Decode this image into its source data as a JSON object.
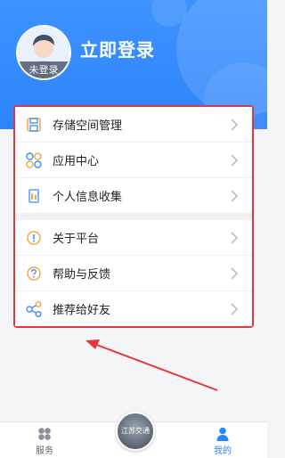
{
  "header": {
    "avatar_tag": "未登录",
    "login_title": "立即登录"
  },
  "menu": {
    "group1": [
      {
        "label": "存储空间管理",
        "icon": "storage-icon"
      },
      {
        "label": "应用中心",
        "icon": "apps-icon"
      },
      {
        "label": "个人信息收集",
        "icon": "document-icon"
      }
    ],
    "group2": [
      {
        "label": "关于平台",
        "icon": "info-icon"
      },
      {
        "label": "帮助与反馈",
        "icon": "help-icon"
      },
      {
        "label": "推荐给好友",
        "icon": "share-icon"
      }
    ]
  },
  "tabbar": {
    "services_label": "服务",
    "center_label": "江苏交通",
    "mine_label": "我的"
  },
  "colors": {
    "header_blue": "#2d83fb",
    "accent_blue": "#2d83fb",
    "highlight_red": "#e6353b",
    "icon_orange": "#f2a93b"
  }
}
